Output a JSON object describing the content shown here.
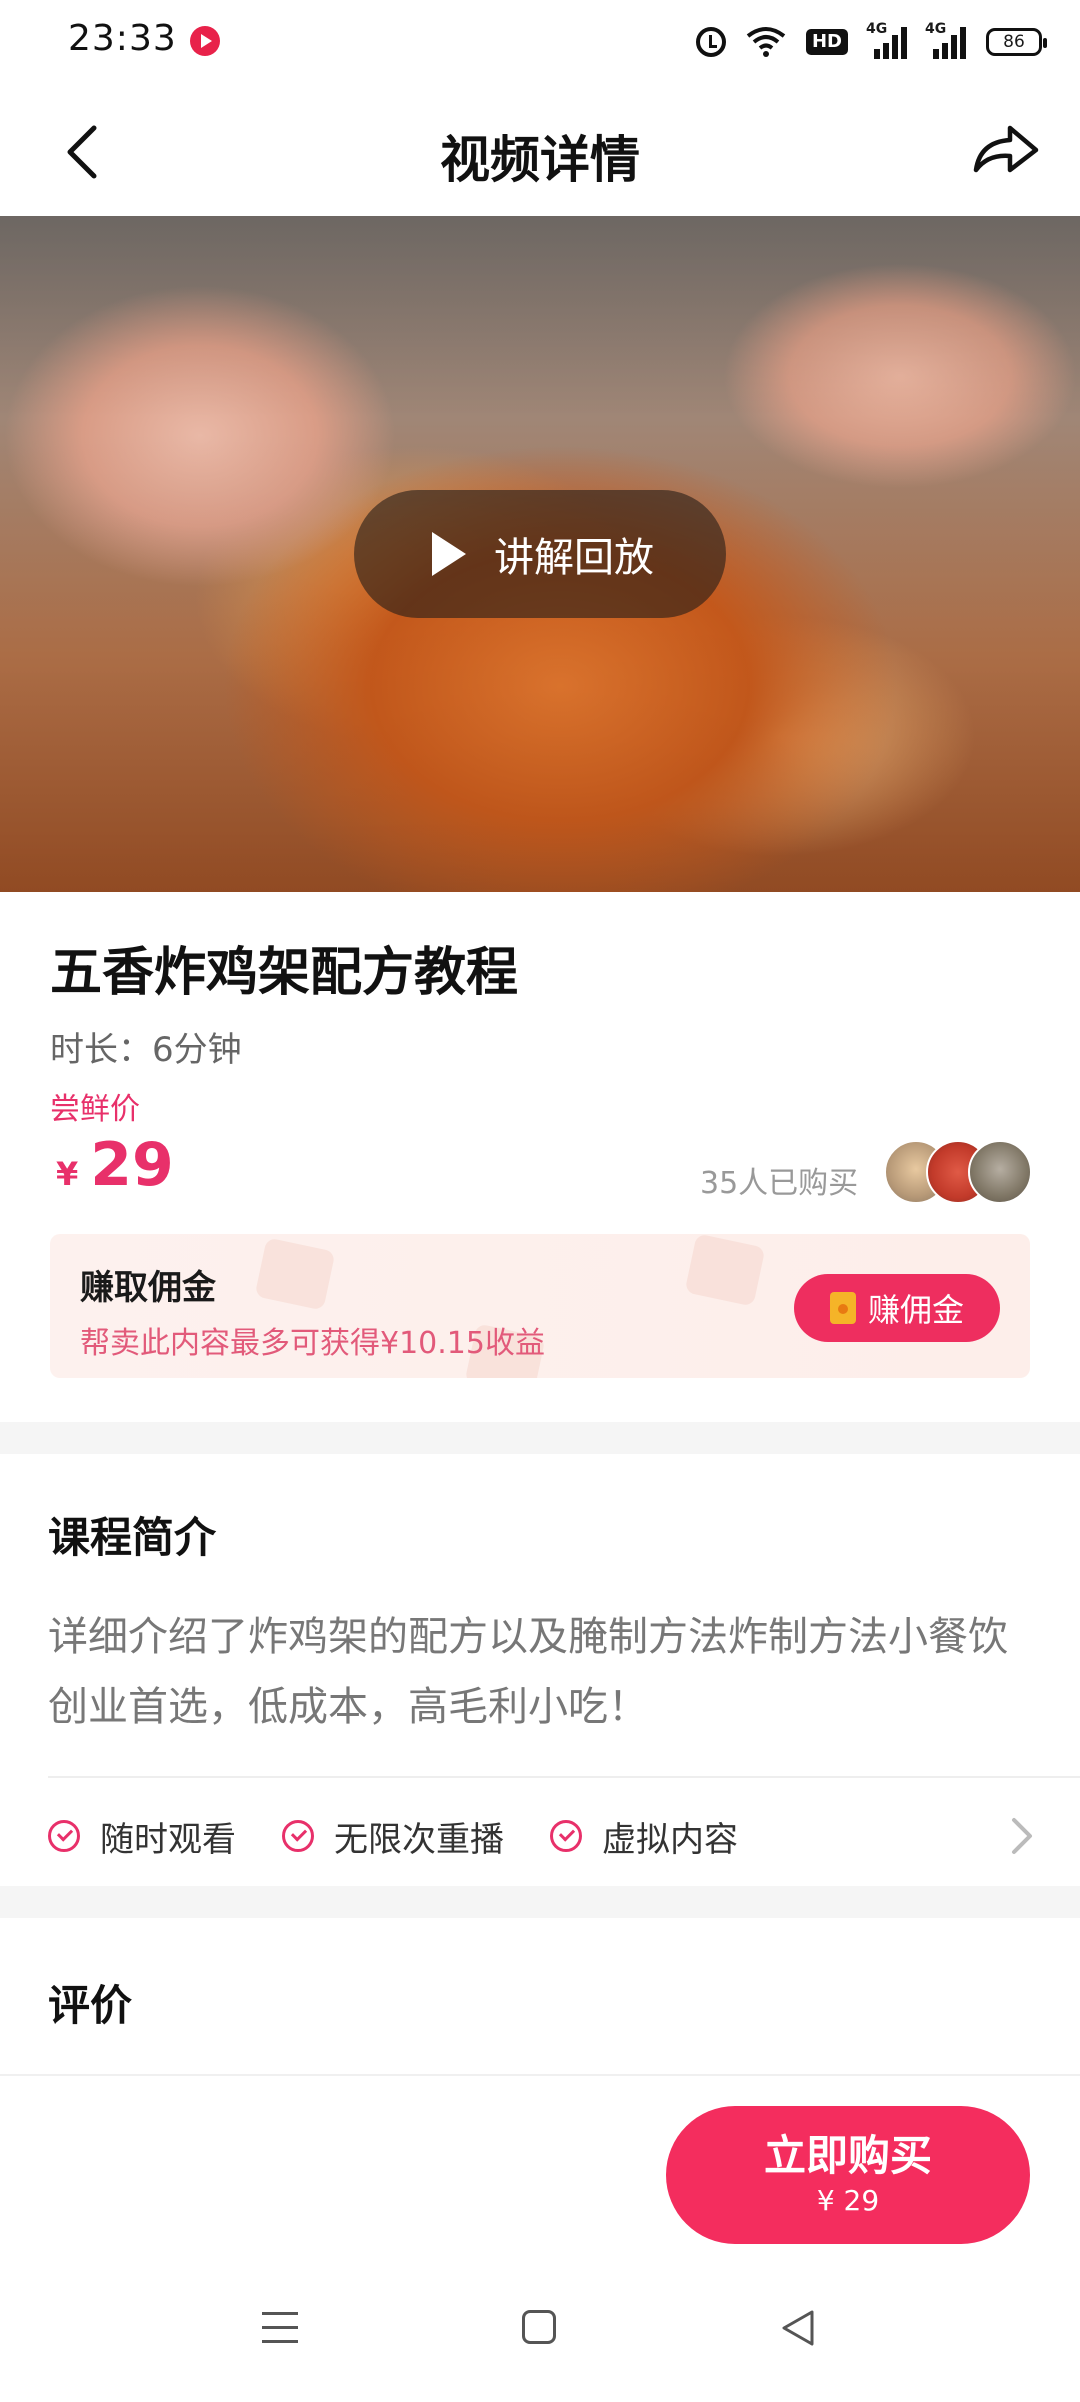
{
  "status_bar": {
    "time": "23:33",
    "hd_label": "HD",
    "signal1_label": "4G",
    "signal2_label": "4G",
    "battery": "86"
  },
  "nav": {
    "title": "视频详情",
    "back_icon": "chevron-left-icon",
    "share_icon": "share-icon"
  },
  "hero": {
    "play_label": "讲解回放",
    "play_icon": "play-icon"
  },
  "product": {
    "title": "五香炸鸡架配方教程",
    "duration": "时长：6分钟",
    "price_label": "尝鲜价",
    "price_currency": "¥",
    "price": "29",
    "buyers": "35人已购买"
  },
  "commission": {
    "title": "赚取佣金",
    "subtitle": "帮卖此内容最多可获得¥10.15收益",
    "button_label": "赚佣金"
  },
  "intro": {
    "title": "课程简介",
    "body": "详细介绍了炸鸡架的配方以及腌制方法炸制方法小餐饮创业首选，低成本，高毛利小吃！",
    "features": [
      "随时观看",
      "无限次重播",
      "虚拟内容"
    ]
  },
  "review": {
    "title": "评价"
  },
  "bottom": {
    "buy_label": "立即购买",
    "buy_price": "¥ 29"
  },
  "colors": {
    "accent": "#f42d5e",
    "price_pink": "#e8306a"
  }
}
